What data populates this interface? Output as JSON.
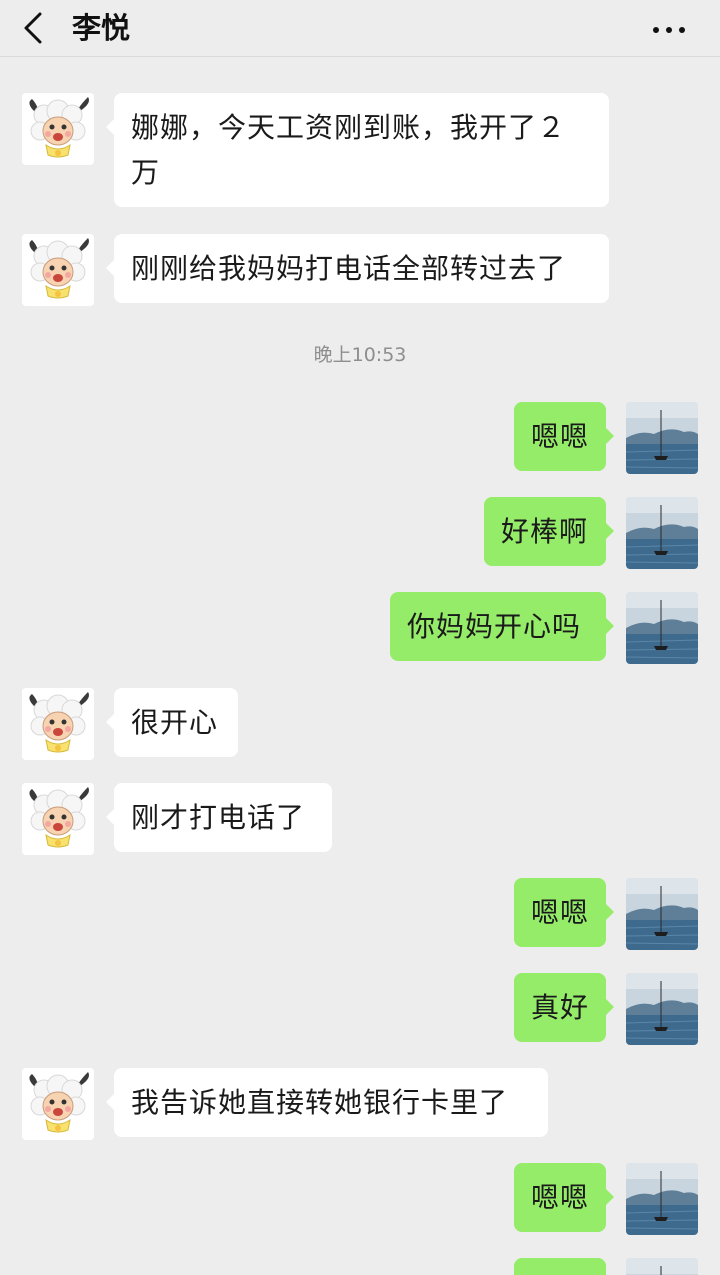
{
  "header": {
    "title": "李悦",
    "back_icon": "chevron-left-icon",
    "more_icon": "more-dots-icon"
  },
  "colors": {
    "background": "#EDEDED",
    "incoming_bubble": "#FFFFFF",
    "outgoing_bubble": "#95EC69"
  },
  "timestamp": "晚上10:53",
  "messages": [
    {
      "from": "contact",
      "text": "娜娜，今天工资刚到账，我开了２万"
    },
    {
      "from": "contact",
      "text": "刚刚给我妈妈打电话全部转过去了"
    },
    {
      "from": "me",
      "text": "嗯嗯"
    },
    {
      "from": "me",
      "text": "好棒啊"
    },
    {
      "from": "me",
      "text": "你妈妈开心吗"
    },
    {
      "from": "contact",
      "text": "很开心"
    },
    {
      "from": "contact",
      "text": "刚才打电话了"
    },
    {
      "from": "me",
      "text": "嗯嗯"
    },
    {
      "from": "me",
      "text": "真好"
    },
    {
      "from": "contact",
      "text": "我告诉她直接转她银行卡里了"
    },
    {
      "from": "me",
      "text": "嗯嗯"
    }
  ],
  "avatars": {
    "contact": "sheep-cartoon-avatar",
    "me": "lake-sailboat-avatar"
  }
}
